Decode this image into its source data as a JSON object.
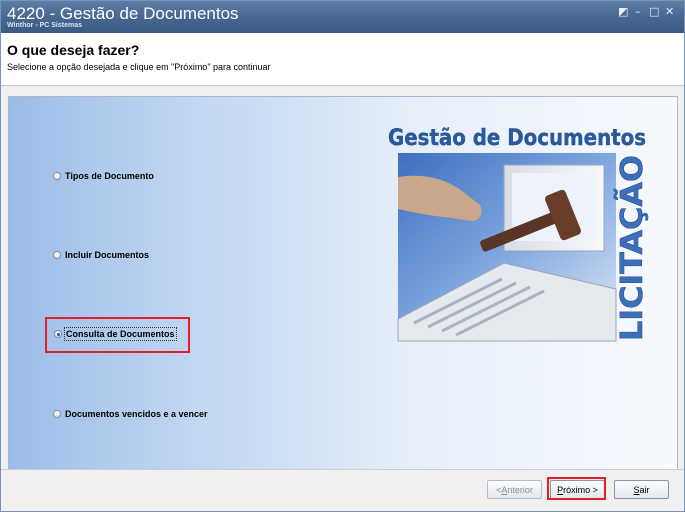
{
  "window": {
    "title": "4220 - Gestão de Documentos",
    "subtitle": "Winthor - PC Sistemas",
    "controls": {
      "restore": "◩",
      "minimize": "–",
      "maximize": "□",
      "close": "✕"
    }
  },
  "header": {
    "title": "O que deseja fazer?",
    "subtitle": "Selecione a opção desejada e clique em \"Próximo\" para continuar"
  },
  "options": [
    {
      "label": "Tipos de Documento",
      "selected": false
    },
    {
      "label": "Incluir Documentos",
      "selected": false
    },
    {
      "label": "Consulta de Documentos",
      "selected": true
    },
    {
      "label": "Documentos vencidos e a vencer",
      "selected": false
    }
  ],
  "illustration": {
    "heading": "Gestão de Documentos",
    "vertical_text": "LICITAÇÃO"
  },
  "footer": {
    "back": {
      "prefix": "< ",
      "accel": "A",
      "rest": "nterior",
      "enabled": false
    },
    "next": {
      "accel": "P",
      "rest": "róximo >",
      "enabled": true
    },
    "exit": {
      "accel": "S",
      "rest": "air",
      "enabled": true
    }
  },
  "colors": {
    "highlight": "#e31e24",
    "titlebar": "#46658f",
    "art_text": "#2a5a9e"
  }
}
